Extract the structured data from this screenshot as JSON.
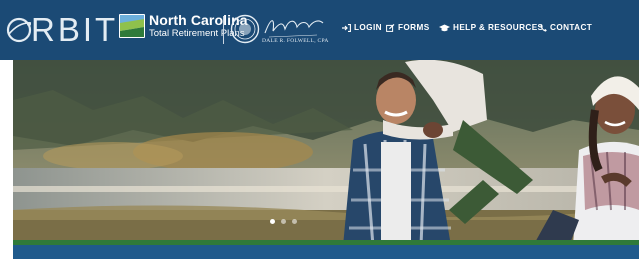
{
  "brand": {
    "orbit_wordmark": "RBIT",
    "nc_title": "North Carolina",
    "nc_subtitle": "Total Retirement Plans",
    "signature_name": "DALE R. FOLWELL, CPA",
    "signature_caption": "STATE TREASURER OF NORTH CAROLINA"
  },
  "nav": [
    {
      "label": "LOGIN",
      "icon": "login-icon"
    },
    {
      "label": "FORMS",
      "icon": "edit-icon"
    },
    {
      "label": "HELP & RESOURCES",
      "icon": "graduation-cap-icon"
    },
    {
      "label": "CONTACT",
      "icon": "phone-icon"
    }
  ],
  "hero": {
    "image": "family-piggyback-lake-photo",
    "slide_count": 3,
    "active_slide": 1
  },
  "colors": {
    "header_bg": "#1b4a75",
    "accent_green": "#2f7a3a",
    "accent_blue": "#1f5a8c"
  }
}
